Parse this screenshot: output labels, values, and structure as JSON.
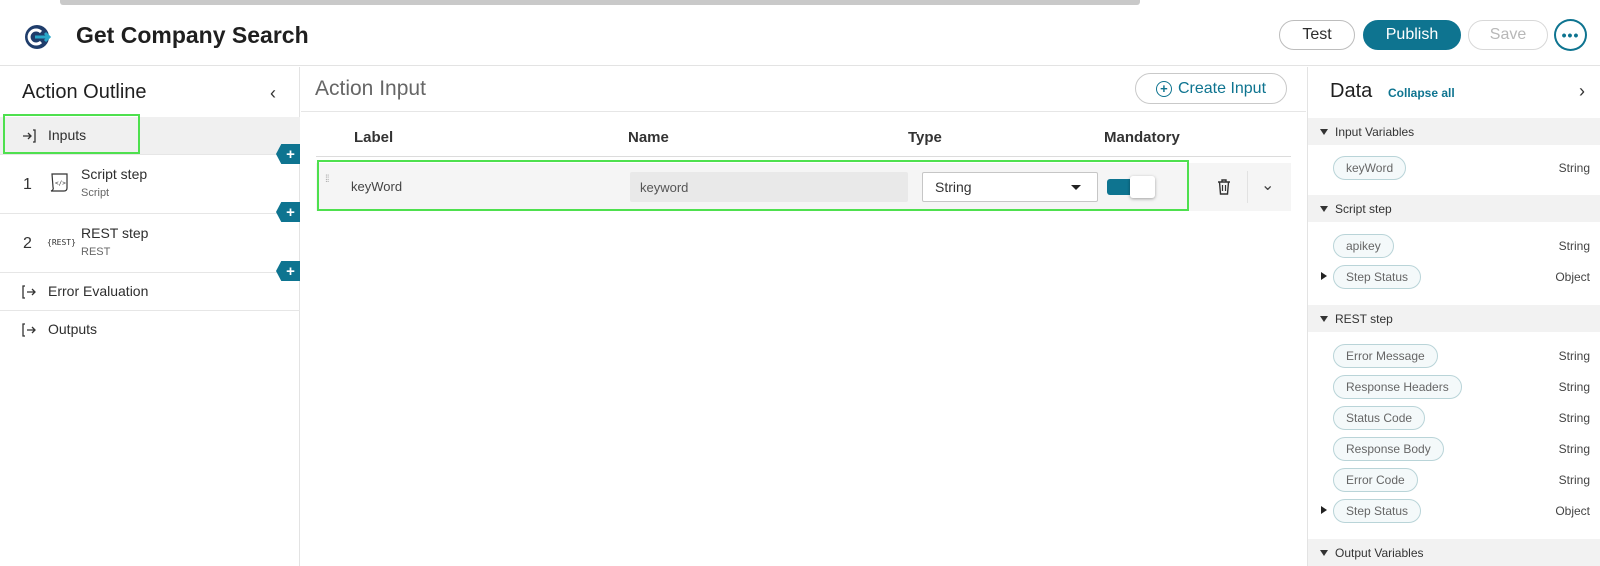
{
  "header": {
    "title": "Get Company Search",
    "logo_icon": "connector-logo-icon",
    "buttons": {
      "test": "Test",
      "publish": "Publish",
      "save": "Save",
      "more": "•••"
    }
  },
  "outline": {
    "title": "Action Outline",
    "items": [
      {
        "label": "Inputs",
        "icon": "input-arrow-icon"
      },
      {
        "number": "1",
        "label": "Script step",
        "sub": "Script",
        "icon": "script-icon"
      },
      {
        "number": "2",
        "label": "REST step",
        "sub": "REST",
        "icon": "rest-icon",
        "icon_text": "{REST}"
      },
      {
        "label": "Error Evaluation",
        "icon": "output-arrow-icon"
      },
      {
        "label": "Outputs",
        "icon": "output-arrow-icon"
      }
    ]
  },
  "action_input": {
    "title": "Action Input",
    "create_button": "Create Input",
    "columns": {
      "label": "Label",
      "name": "Name",
      "type": "Type",
      "mandatory": "Mandatory"
    },
    "rows": [
      {
        "label": "keyWord",
        "name": "keyword",
        "type": "String",
        "mandatory": true
      }
    ]
  },
  "data_panel": {
    "title": "Data",
    "collapse_all": "Collapse all",
    "sections": [
      {
        "title": "Input Variables",
        "vars": [
          {
            "name": "keyWord",
            "type": "String"
          }
        ]
      },
      {
        "title": "Script step",
        "vars": [
          {
            "name": "apikey",
            "type": "String"
          },
          {
            "name": "Step Status",
            "type": "Object",
            "expandable": true
          }
        ]
      },
      {
        "title": "REST step",
        "vars": [
          {
            "name": "Error Message",
            "type": "String"
          },
          {
            "name": "Response Headers",
            "type": "String"
          },
          {
            "name": "Status Code",
            "type": "String"
          },
          {
            "name": "Response Body",
            "type": "String"
          },
          {
            "name": "Error Code",
            "type": "String"
          },
          {
            "name": "Step Status",
            "type": "Object",
            "expandable": true
          }
        ]
      },
      {
        "title": "Output Variables",
        "vars": []
      }
    ]
  },
  "colors": {
    "accent": "#0e7490",
    "highlight": "#4ee04e"
  }
}
